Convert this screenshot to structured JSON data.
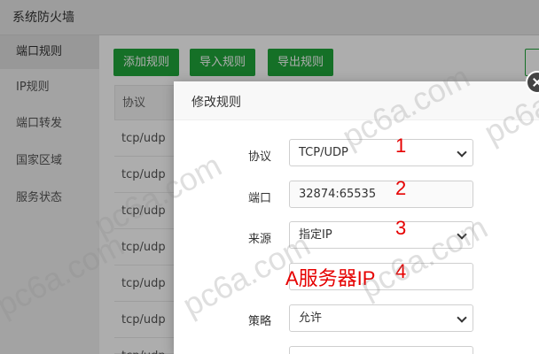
{
  "window": {
    "title": "系统防火墙"
  },
  "sidebar": {
    "items": [
      {
        "label": "端口规则",
        "active": true
      },
      {
        "label": "IP规则",
        "active": false
      },
      {
        "label": "端口转发",
        "active": false
      },
      {
        "label": "国家区域",
        "active": false
      },
      {
        "label": "服务状态",
        "active": false
      }
    ]
  },
  "toolbar": {
    "add_label": "添加规则",
    "import_label": "导入规则",
    "export_label": "导出规则",
    "accent": "#20a53a"
  },
  "table": {
    "header": "协议",
    "rows": [
      "tcp/udp",
      "tcp/udp",
      "tcp/udp",
      "tcp/udp",
      "tcp/udp",
      "tcp/udp",
      "tcp/udp"
    ]
  },
  "dialog": {
    "title": "修改规则",
    "protocol": {
      "label": "协议",
      "value": "TCP/UDP"
    },
    "port": {
      "label": "端口",
      "value": "32874:65535"
    },
    "source": {
      "label": "来源",
      "value": "指定IP"
    },
    "ip": {
      "value": ""
    },
    "policy": {
      "label": "策略",
      "value": "允许"
    }
  },
  "annotations": {
    "n1": "1",
    "n2": "2",
    "n3": "3",
    "n4": "4",
    "ip_note": "A服务器IP",
    "color": "#e60000"
  },
  "watermark": {
    "text": "pc6a.com"
  }
}
